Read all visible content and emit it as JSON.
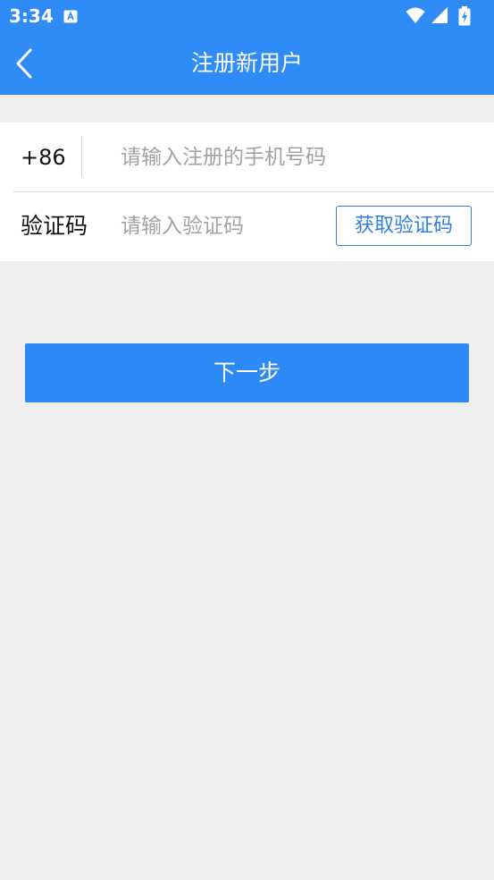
{
  "status_bar": {
    "time": "3:34",
    "icons": [
      "app-notification-icon",
      "wifi-icon",
      "signal-icon",
      "battery-charging-icon"
    ]
  },
  "header": {
    "title": "注册新用户",
    "back_icon": "chevron-left-icon"
  },
  "form": {
    "country_code": "+86",
    "phone_placeholder": "请输入注册的手机号码",
    "phone_value": "",
    "code_label": "验证码",
    "code_placeholder": "请输入验证码",
    "code_value": "",
    "get_code_label": "获取验证码"
  },
  "actions": {
    "next_label": "下一步"
  },
  "colors": {
    "primary": "#2f8bf6",
    "background": "#efefef",
    "placeholder": "#a2a2a2"
  }
}
